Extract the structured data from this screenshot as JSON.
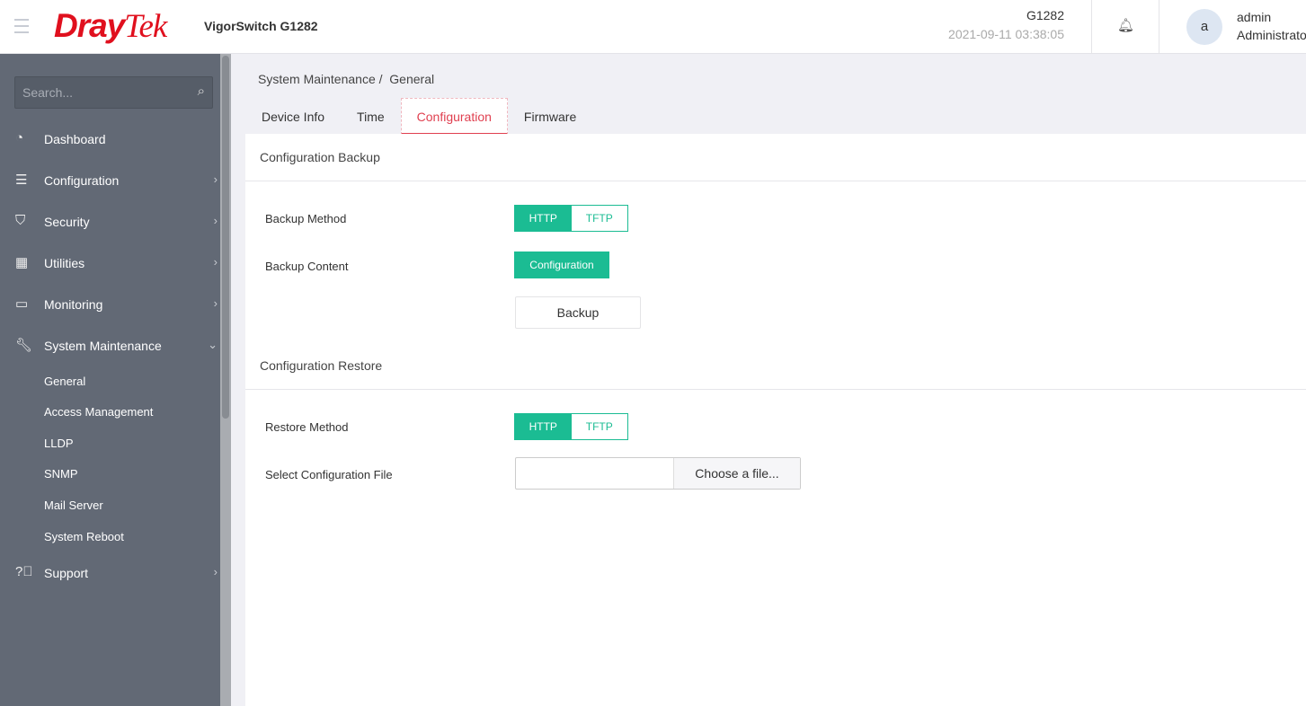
{
  "header": {
    "brand_logo": "DrayTek",
    "product": "VigorSwitch G1282",
    "model": "G1282",
    "datetime": "2021-09-11 03:38:05",
    "user": {
      "avatar_letter": "a",
      "name": "admin",
      "role": "Administrator"
    }
  },
  "sidebar": {
    "search_placeholder": "Search...",
    "items": [
      {
        "label": "Dashboard"
      },
      {
        "label": "Configuration"
      },
      {
        "label": "Security"
      },
      {
        "label": "Utilities"
      },
      {
        "label": "Monitoring"
      },
      {
        "label": "System Maintenance"
      },
      {
        "label": "Support"
      }
    ],
    "sub_items": [
      "General",
      "Access Management",
      "LLDP",
      "SNMP",
      "Mail Server",
      "System Reboot"
    ]
  },
  "breadcrumb": {
    "parent": "System Maintenance",
    "sep": "/",
    "current": "General"
  },
  "tabs": [
    "Device Info",
    "Time",
    "Configuration",
    "Firmware"
  ],
  "backup": {
    "title": "Configuration Backup",
    "method_label": "Backup Method",
    "methods": [
      "HTTP",
      "TFTP"
    ],
    "content_label": "Backup Content",
    "content_value": "Configuration",
    "button": "Backup"
  },
  "restore": {
    "title": "Configuration Restore",
    "method_label": "Restore Method",
    "methods": [
      "HTTP",
      "TFTP"
    ],
    "file_label": "Select Configuration File",
    "file_button": "Choose a file..."
  },
  "colors": {
    "accent": "#1bbc93",
    "active_tab": "#e04050",
    "sidebar": "#626975"
  }
}
